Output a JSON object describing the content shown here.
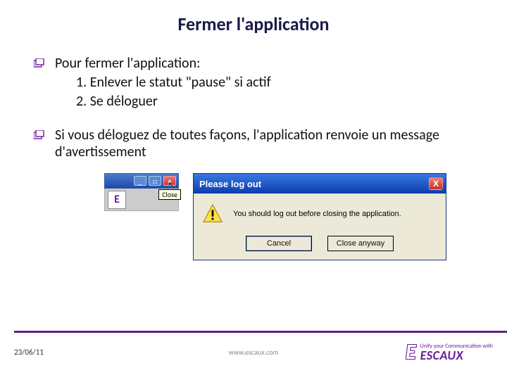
{
  "title": "Fermer l'application",
  "bullets": {
    "b1": "Pour fermer l'application:",
    "n1": "1.   Enlever le statut \"pause\" si actif",
    "n2": "2.   Se déloguer",
    "b2": "Si vous déloguez de toutes façons, l'application renvoie un message d'avertissement"
  },
  "mini": {
    "tooltip": "Close"
  },
  "dialog": {
    "title": "Please log out",
    "message": "You should log out before closing the application.",
    "cancel": "Cancel",
    "close_anyway": "Close anyway"
  },
  "footer": {
    "date": "23/06/11",
    "url": "www.escaux.com",
    "brand_tag": "Unify your Communication with",
    "brand_name": "ESCAUX"
  }
}
